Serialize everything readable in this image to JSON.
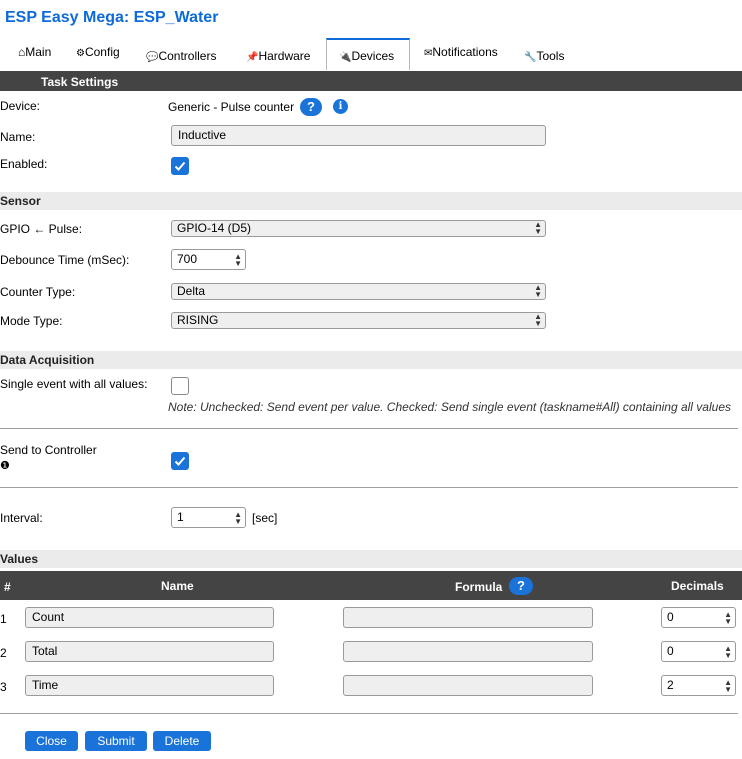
{
  "app_title": "ESP Easy Mega: ESP_Water",
  "tabs": [
    {
      "icon": "⌂",
      "label": "Main"
    },
    {
      "icon": "⚙",
      "label": "Config"
    },
    {
      "icon": "💬",
      "label": "Controllers"
    },
    {
      "icon": "📌",
      "label": "Hardware"
    },
    {
      "icon": "🔌",
      "label": "Devices",
      "active": true
    },
    {
      "icon": "✉",
      "label": "Notifications"
    },
    {
      "icon": "🔧",
      "label": "Tools"
    }
  ],
  "task_settings": {
    "header": "Task Settings",
    "device_label": "Device:",
    "device_value": "Generic - Pulse counter",
    "help_glyph": "?",
    "info_glyph": "i",
    "name_label": "Name:",
    "name_value": "Inductive",
    "enabled_label": "Enabled:",
    "enabled": true
  },
  "sensor": {
    "header": "Sensor",
    "gpio_label": "GPIO ← Pulse:",
    "gpio_value": "GPIO-14 (D5)",
    "debounce_label": "Debounce Time (mSec):",
    "debounce_value": "700",
    "counter_type_label": "Counter Type:",
    "counter_type_value": "Delta",
    "mode_type_label": "Mode Type:",
    "mode_type_value": "RISING"
  },
  "data_acquisition": {
    "header": "Data Acquisition",
    "single_event_label": "Single event with all values:",
    "single_event": false,
    "note": "Note: Unchecked: Send event per value. Checked: Send single event (taskname#All) containing all values",
    "send_controller_label": "Send to Controller",
    "send_controller_info_glyph": "❶",
    "send_controller": true,
    "interval_label": "Interval:",
    "interval_value": "1",
    "interval_unit": "[sec]"
  },
  "values": {
    "header": "Values",
    "col_num": "#",
    "col_name": "Name",
    "col_formula": "Formula",
    "col_decimals": "Decimals",
    "rows": [
      {
        "num": "1",
        "name": "Count",
        "formula": "",
        "decimals": "0"
      },
      {
        "num": "2",
        "name": "Total",
        "formula": "",
        "decimals": "0"
      },
      {
        "num": "3",
        "name": "Time",
        "formula": "",
        "decimals": "2"
      }
    ]
  },
  "buttons": {
    "close": "Close",
    "submit": "Submit",
    "delete": "Delete"
  },
  "colors": {
    "accent": "#1a73d9",
    "title": "#0d6ad8",
    "header_dark": "#444444",
    "header_light": "#ebebeb"
  }
}
